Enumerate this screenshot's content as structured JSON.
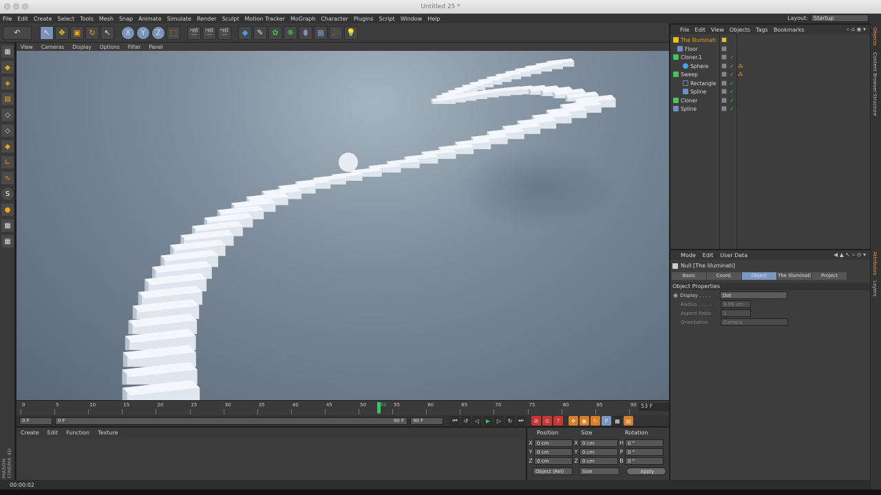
{
  "window": {
    "title": "Untitled 25 *"
  },
  "menubar": {
    "items": [
      "File",
      "Edit",
      "Create",
      "Select",
      "Tools",
      "Mesh",
      "Snap",
      "Animate",
      "Simulate",
      "Render",
      "Sculpt",
      "Motion Tracker",
      "MoGraph",
      "Character",
      "Plugins",
      "Script",
      "Window",
      "Help"
    ],
    "layout_label": "Layout:",
    "layout_value": "Startup"
  },
  "viewport": {
    "menu": [
      "View",
      "Cameras",
      "Display",
      "Options",
      "Filter",
      "Panel"
    ]
  },
  "timeline": {
    "ticks": [
      "0",
      "5",
      "10",
      "15",
      "20",
      "25",
      "30",
      "35",
      "40",
      "45",
      "50",
      "53",
      "55",
      "60",
      "65",
      "70",
      "75",
      "80",
      "85",
      "90"
    ],
    "current_frame": "53",
    "end_frame_label": "53 F"
  },
  "transport": {
    "start": "0 F",
    "range_start": "0 F",
    "range_end": "90 F",
    "end": "90 F"
  },
  "material": {
    "menu": [
      "Create",
      "Edit",
      "Function",
      "Texture"
    ]
  },
  "maxon": {
    "brand": "MAXON CINEMA 4D"
  },
  "coords": {
    "headers": [
      "Position",
      "Size",
      "Rotation"
    ],
    "rows": [
      {
        "ax1": "X",
        "v1": "0 cm",
        "ax2": "X",
        "v2": "0 cm",
        "ax3": "H",
        "v3": "0 °"
      },
      {
        "ax1": "Y",
        "v1": "0 cm",
        "ax2": "Y",
        "v2": "0 cm",
        "ax3": "P",
        "v3": "0 °"
      },
      {
        "ax1": "Z",
        "v1": "0 cm",
        "ax2": "Z",
        "v2": "0 cm",
        "ax3": "B",
        "v3": "0 °"
      }
    ],
    "mode": "Object (Rel)",
    "size_mode": "Size",
    "apply": "Apply"
  },
  "status": {
    "time": "00:00:02"
  },
  "objects": {
    "menu": [
      "File",
      "Edit",
      "View",
      "Objects",
      "Tags",
      "Bookmarks"
    ],
    "items": [
      {
        "label": "The Illuminati",
        "indent": 0,
        "color": "#e8c020"
      },
      {
        "label": "Floor",
        "indent": 0,
        "color": "#6f8fc8"
      },
      {
        "label": "Cloner.1",
        "indent": 0,
        "color": "#45c45a"
      },
      {
        "label": "Sphere",
        "indent": 1,
        "color": "#4aa0e8"
      },
      {
        "label": "Sweep",
        "indent": 0,
        "color": "#45c45a"
      },
      {
        "label": "Rectangle",
        "indent": 1,
        "color": "#6f8fc8"
      },
      {
        "label": "Spline",
        "indent": 1,
        "color": "#6f8fc8"
      },
      {
        "label": "Cloner",
        "indent": 0,
        "color": "#45c45a"
      },
      {
        "label": "Spline",
        "indent": 0,
        "color": "#6f8fc8"
      }
    ]
  },
  "attributes": {
    "menu": [
      "Mode",
      "Edit",
      "User Data"
    ],
    "title": "Null [The Illuminati]",
    "tabs": [
      "Basic",
      "Coord.",
      "Object",
      "The Illuminati",
      "Project"
    ],
    "section": "Object Properties",
    "props": [
      {
        "label": "Display . . . .",
        "value": "Dot"
      },
      {
        "label": "Radius . . . . .",
        "value": "9.99 cm"
      },
      {
        "label": "Aspect Ratio",
        "value": "1"
      },
      {
        "label": "Orientation",
        "value": "Camera"
      }
    ]
  },
  "right_tabs": [
    "Objects",
    "Content Browser",
    "Structure",
    "Attributes",
    "Layers"
  ]
}
